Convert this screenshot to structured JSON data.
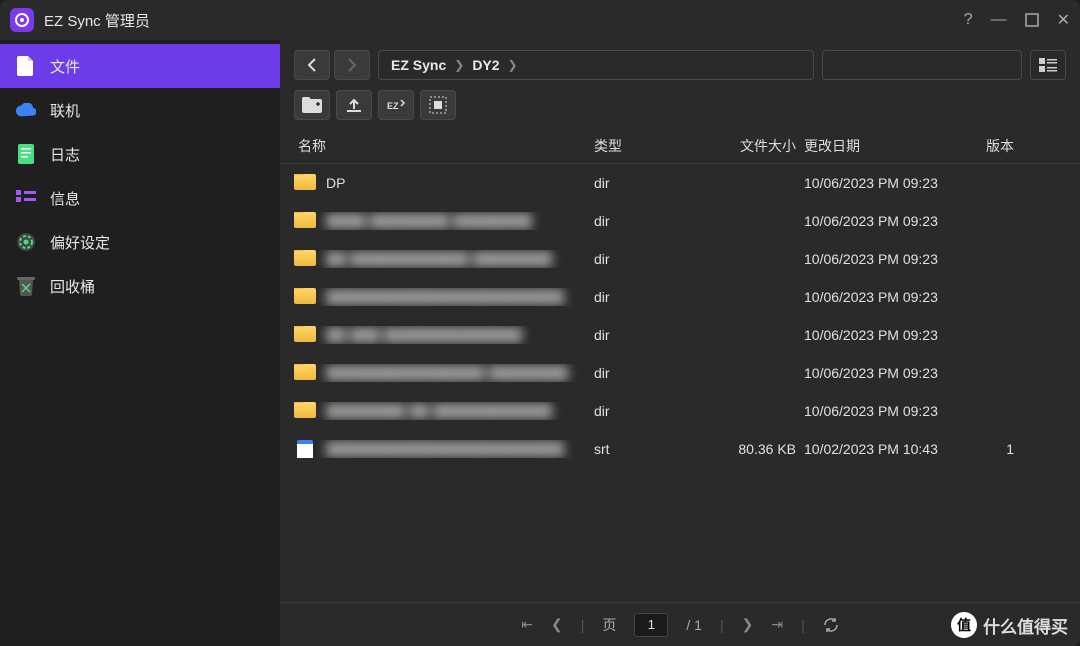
{
  "window": {
    "title": "EZ Sync 管理员"
  },
  "sidebar": {
    "items": [
      {
        "label": "文件",
        "icon": "file"
      },
      {
        "label": "联机",
        "icon": "cloud"
      },
      {
        "label": "日志",
        "icon": "log"
      },
      {
        "label": "信息",
        "icon": "info"
      },
      {
        "label": "偏好设定",
        "icon": "gear"
      },
      {
        "label": "回收桶",
        "icon": "trash"
      }
    ]
  },
  "breadcrumb": {
    "items": [
      "EZ Sync",
      "DY2"
    ]
  },
  "columns": {
    "name": "名称",
    "type": "类型",
    "size": "文件大小",
    "date": "更改日期",
    "ver": "版本"
  },
  "rows": [
    {
      "name": "DP",
      "blurred": false,
      "kind": "folder",
      "type": "dir",
      "size": "",
      "date": "10/06/2023 PM 09:23",
      "ver": ""
    },
    {
      "name": "████ ████████ ████████",
      "blurred": true,
      "kind": "folder",
      "type": "dir",
      "size": "",
      "date": "10/06/2023 PM 09:23",
      "ver": ""
    },
    {
      "name": "██ ████████████ ████████",
      "blurred": true,
      "kind": "folder",
      "type": "dir",
      "size": "",
      "date": "10/06/2023 PM 09:23",
      "ver": ""
    },
    {
      "name": "████████████████████████",
      "blurred": true,
      "kind": "folder",
      "type": "dir",
      "size": "",
      "date": "10/06/2023 PM 09:23",
      "ver": ""
    },
    {
      "name": "██ ███ ██████████████",
      "blurred": true,
      "kind": "folder",
      "type": "dir",
      "size": "",
      "date": "10/06/2023 PM 09:23",
      "ver": ""
    },
    {
      "name": "████████████████ ████████",
      "blurred": true,
      "kind": "folder",
      "type": "dir",
      "size": "",
      "date": "10/06/2023 PM 09:23",
      "ver": ""
    },
    {
      "name": "████████ ██ ████████████",
      "blurred": true,
      "kind": "folder",
      "type": "dir",
      "size": "",
      "date": "10/06/2023 PM 09:23",
      "ver": ""
    },
    {
      "name": "████████████████████████",
      "blurred": true,
      "kind": "srt",
      "type": "srt",
      "size": "80.36 KB",
      "date": "10/02/2023 PM 10:43",
      "ver": "1"
    }
  ],
  "pager": {
    "label": "页",
    "current": "1",
    "total": "/ 1"
  },
  "watermark": {
    "badge": "值",
    "text": "什么值得买"
  }
}
